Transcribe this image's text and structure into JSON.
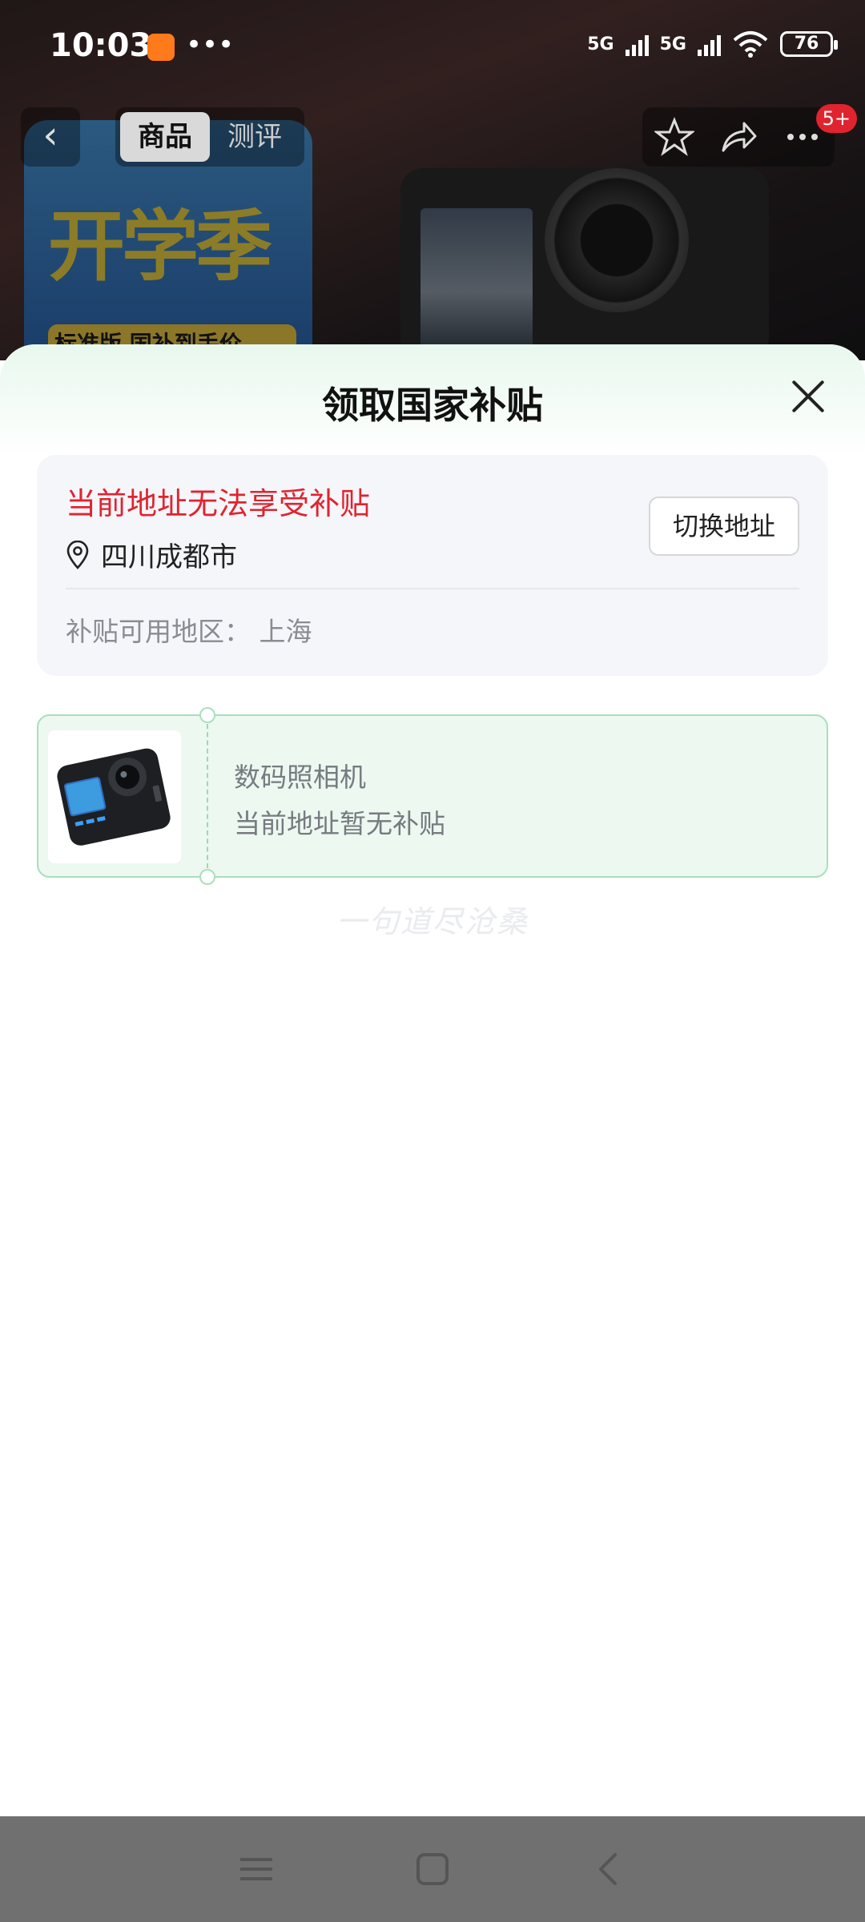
{
  "status_bar": {
    "time": "10:03",
    "dots": "•••",
    "signal1_label": "5G",
    "signal2_label": "5G",
    "battery": "76"
  },
  "background_page": {
    "promo_text": "开学季",
    "promo_strip": "标准版 国补到手价"
  },
  "top_nav": {
    "tabs": [
      {
        "label": "商品",
        "active": true
      },
      {
        "label": "测评",
        "active": false
      }
    ],
    "badge": "5+"
  },
  "sheet": {
    "title": "领取国家补贴",
    "address": {
      "warning": "当前地址无法享受补贴",
      "current": "四川成都市",
      "switch_label": "切换地址",
      "available_regions": "补贴可用地区： 上海"
    },
    "product": {
      "name": "数码照相机",
      "status": "当前地址暂无补贴"
    },
    "watermark": "一句道尽沧桑"
  },
  "colors": {
    "warning": "#e0242f",
    "coupon_bg": "#ecf8f0",
    "coupon_border": "#a9dfbd",
    "sheet_header_tint": "#e8f8ee"
  }
}
